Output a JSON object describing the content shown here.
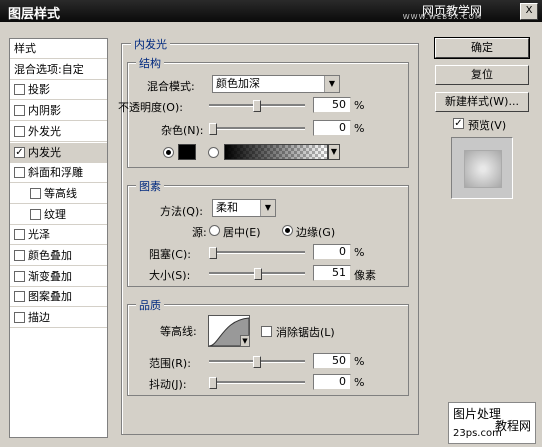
{
  "window": {
    "title": "图层样式",
    "watermark": "网页教学网",
    "watermark_url": "WWW.WEB3X.COM",
    "close_glyph": "X"
  },
  "sidebar": {
    "header": "样式",
    "items": [
      {
        "label": "混合选项:自定",
        "checkbox": false
      },
      {
        "label": "投影",
        "checkbox": true,
        "checked": false
      },
      {
        "label": "内阴影",
        "checkbox": true,
        "checked": false
      },
      {
        "label": "外发光",
        "checkbox": true,
        "checked": false
      },
      {
        "label": "内发光",
        "checkbox": true,
        "checked": true,
        "selected": true
      },
      {
        "label": "斜面和浮雕",
        "checkbox": true,
        "checked": false
      },
      {
        "label": "等高线",
        "checkbox": true,
        "checked": false,
        "indent": true
      },
      {
        "label": "纹理",
        "checkbox": true,
        "checked": false,
        "indent": true
      },
      {
        "label": "光泽",
        "checkbox": true,
        "checked": false
      },
      {
        "label": "颜色叠加",
        "checkbox": true,
        "checked": false
      },
      {
        "label": "渐变叠加",
        "checkbox": true,
        "checked": false
      },
      {
        "label": "图案叠加",
        "checkbox": true,
        "checked": false
      },
      {
        "label": "描边",
        "checkbox": true,
        "checked": false
      }
    ]
  },
  "panel": {
    "title": "内发光",
    "structure": {
      "title": "结构",
      "blend_mode_label": "混合模式:",
      "blend_mode_value": "颜色加深",
      "opacity_label": "不透明度(O):",
      "opacity_value": "50",
      "opacity_level": 50,
      "noise_label": "杂色(N):",
      "noise_value": "0",
      "noise_level": 0,
      "percent": "%",
      "glow_color": "#000000",
      "dropdown_glyph": "▼"
    },
    "elements": {
      "title": "图素",
      "method_label": "方法(Q):",
      "method_value": "柔和",
      "source_label": "源:",
      "source_center": "居中(E)",
      "source_edge": "边缘(G)",
      "source_selected": "edge",
      "choke_label": "阻塞(C):",
      "choke_value": "0",
      "choke_level": 0,
      "size_label": "大小(S):",
      "size_value": "51",
      "size_level": 51,
      "size_unit": "像素",
      "percent": "%"
    },
    "quality": {
      "title": "品质",
      "contour_label": "等高线:",
      "antialias_label": "消除锯齿(L)",
      "antialias_checked": false,
      "range_label": "范围(R):",
      "range_value": "50",
      "range_level": 50,
      "jitter_label": "抖动(J):",
      "jitter_value": "0",
      "jitter_level": 0,
      "percent": "%"
    }
  },
  "buttons": {
    "ok": "确定",
    "reset": "复位",
    "new_style": "新建样式(W)...",
    "preview_label": "预览(V)",
    "preview_checked": true
  },
  "stamp": {
    "line1": "图片处理",
    "line2": "教程网",
    "line3": "23ps.com"
  }
}
